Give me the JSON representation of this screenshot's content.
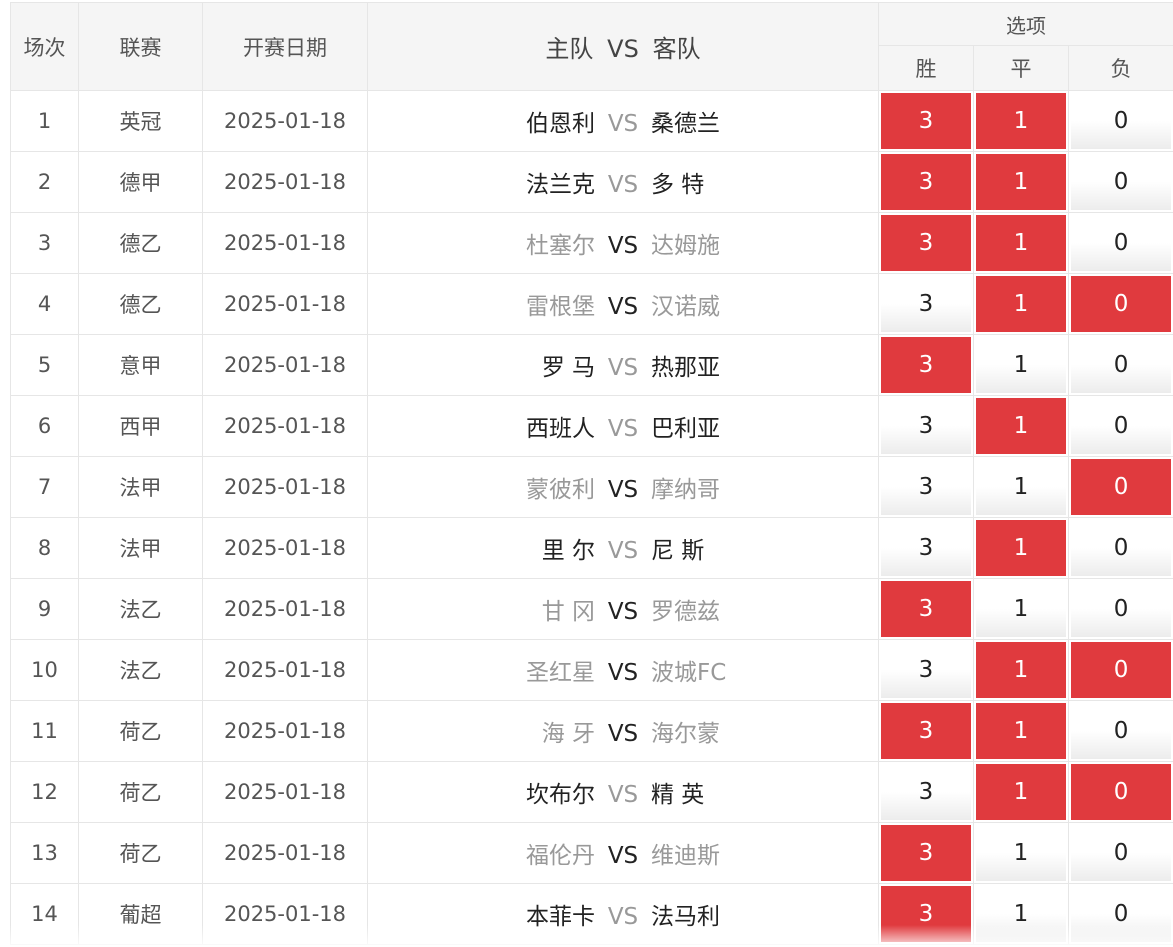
{
  "header": {
    "round": "场次",
    "league": "联赛",
    "date": "开赛日期",
    "home": "主队",
    "vs": "VS",
    "away": "客队",
    "options": "选项",
    "win": "胜",
    "draw": "平",
    "lose": "负"
  },
  "colors": {
    "selected": "#e03a3e",
    "vs_highlight": "#333333",
    "vs_dim": "#999999"
  },
  "option_labels": [
    "3",
    "1",
    "0"
  ],
  "rows": [
    {
      "n": "1",
      "league": "英冠",
      "date": "2025-01-18",
      "home": "伯恩利",
      "away": "桑德兰",
      "home_dim": false,
      "vs_dim": true,
      "away_dim": false,
      "sel": [
        true,
        true,
        false
      ]
    },
    {
      "n": "2",
      "league": "德甲",
      "date": "2025-01-18",
      "home": "法兰克",
      "away": "多 特",
      "home_dim": false,
      "vs_dim": true,
      "away_dim": false,
      "sel": [
        true,
        true,
        false
      ]
    },
    {
      "n": "3",
      "league": "德乙",
      "date": "2025-01-18",
      "home": "杜塞尔",
      "away": "达姆施",
      "home_dim": true,
      "vs_dim": false,
      "away_dim": true,
      "sel": [
        true,
        true,
        false
      ]
    },
    {
      "n": "4",
      "league": "德乙",
      "date": "2025-01-18",
      "home": "雷根堡",
      "away": "汉诺威",
      "home_dim": true,
      "vs_dim": false,
      "away_dim": true,
      "sel": [
        false,
        true,
        true
      ]
    },
    {
      "n": "5",
      "league": "意甲",
      "date": "2025-01-18",
      "home": "罗 马",
      "away": "热那亚",
      "home_dim": false,
      "vs_dim": true,
      "away_dim": false,
      "sel": [
        true,
        false,
        false
      ]
    },
    {
      "n": "6",
      "league": "西甲",
      "date": "2025-01-18",
      "home": "西班人",
      "away": "巴利亚",
      "home_dim": false,
      "vs_dim": true,
      "away_dim": false,
      "sel": [
        false,
        true,
        false
      ]
    },
    {
      "n": "7",
      "league": "法甲",
      "date": "2025-01-18",
      "home": "蒙彼利",
      "away": "摩纳哥",
      "home_dim": true,
      "vs_dim": false,
      "away_dim": true,
      "sel": [
        false,
        false,
        true
      ]
    },
    {
      "n": "8",
      "league": "法甲",
      "date": "2025-01-18",
      "home": "里 尔",
      "away": "尼 斯",
      "home_dim": false,
      "vs_dim": true,
      "away_dim": false,
      "sel": [
        false,
        true,
        false
      ]
    },
    {
      "n": "9",
      "league": "法乙",
      "date": "2025-01-18",
      "home": "甘 冈",
      "away": "罗德兹",
      "home_dim": true,
      "vs_dim": false,
      "away_dim": true,
      "sel": [
        true,
        false,
        false
      ]
    },
    {
      "n": "10",
      "league": "法乙",
      "date": "2025-01-18",
      "home": "圣红星",
      "away": "波城FC",
      "home_dim": true,
      "vs_dim": false,
      "away_dim": true,
      "sel": [
        false,
        true,
        true
      ]
    },
    {
      "n": "11",
      "league": "荷乙",
      "date": "2025-01-18",
      "home": "海 牙",
      "away": "海尔蒙",
      "home_dim": true,
      "vs_dim": false,
      "away_dim": true,
      "sel": [
        true,
        true,
        false
      ]
    },
    {
      "n": "12",
      "league": "荷乙",
      "date": "2025-01-18",
      "home": "坎布尔",
      "away": "精 英",
      "home_dim": false,
      "vs_dim": true,
      "away_dim": false,
      "sel": [
        false,
        true,
        true
      ]
    },
    {
      "n": "13",
      "league": "荷乙",
      "date": "2025-01-18",
      "home": "福伦丹",
      "away": "维迪斯",
      "home_dim": true,
      "vs_dim": false,
      "away_dim": true,
      "sel": [
        true,
        false,
        false
      ]
    },
    {
      "n": "14",
      "league": "葡超",
      "date": "2025-01-18",
      "home": "本菲卡",
      "away": "法马利",
      "home_dim": false,
      "vs_dim": true,
      "away_dim": false,
      "sel": [
        true,
        false,
        false
      ]
    }
  ]
}
